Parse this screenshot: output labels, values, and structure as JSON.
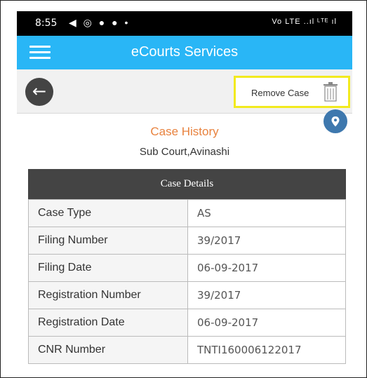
{
  "status_bar": {
    "time": "8:55",
    "right_icons": "Vo LTE ..ıl ᴸᵀᴱ ıl"
  },
  "app_bar": {
    "title": "eCourts Services"
  },
  "toolbar": {
    "remove_label": "Remove Case"
  },
  "case": {
    "history_title": "Case History",
    "court_name": "Sub Court,Avinashi"
  },
  "details": {
    "header": "Case Details",
    "rows": [
      {
        "label": "Case Type",
        "value": "AS"
      },
      {
        "label": "Filing Number",
        "value": "39/2017"
      },
      {
        "label": "Filing Date",
        "value": "06-09-2017"
      },
      {
        "label": "Registration Number",
        "value": "39/2017"
      },
      {
        "label": "Registration Date",
        "value": "06-09-2017"
      },
      {
        "label": "CNR Number",
        "value": "TNTI160006122017"
      }
    ]
  },
  "colors": {
    "app_bar": "#29B6F6",
    "history_title": "#E8823E",
    "highlight_border": "#F2EA1F",
    "details_header": "#444444",
    "location_button": "#3E78AE"
  }
}
